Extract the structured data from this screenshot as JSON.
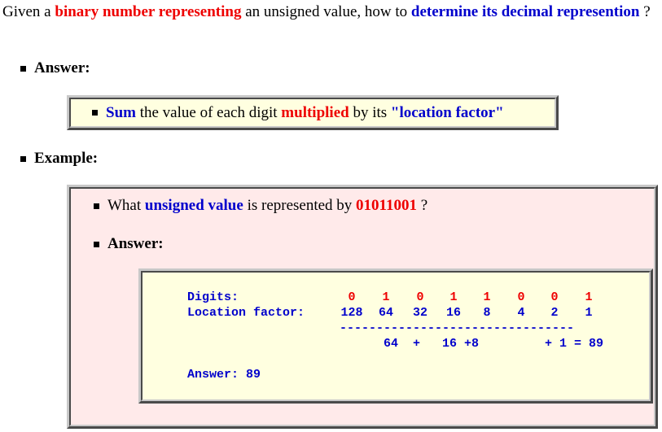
{
  "intro": {
    "p1": "Given a ",
    "h1": "binary number representing",
    "p2": " an unsigned value, how to ",
    "h2": "determine its decimal represention",
    "p3": " ?"
  },
  "answer_heading": "Answer:",
  "answer_box": {
    "h1": "Sum",
    "p1": " the value of each digit ",
    "h2": "multiplied",
    "p2": " by its ",
    "h3": "\"location factor\""
  },
  "example_heading": "Example:",
  "example": {
    "question": {
      "p1": "What ",
      "h1": "unsigned value",
      "p2": " is represented by ",
      "h2": "01011001",
      "p3": " ?"
    },
    "answer_heading": "Answer:",
    "calc": {
      "digits_label": "Digits:",
      "factor_label": "Location factor:",
      "digits": [
        "0",
        "1",
        "0",
        "1",
        "1",
        "0",
        "0",
        "1"
      ],
      "factors": [
        "128",
        "64",
        "32",
        "16",
        "8",
        "4",
        "2",
        "1"
      ],
      "rule": "--------------------------------",
      "sum_line": "64  +   16 +8         + 1 = 89",
      "answer_line": "Answer: 89"
    }
  }
}
